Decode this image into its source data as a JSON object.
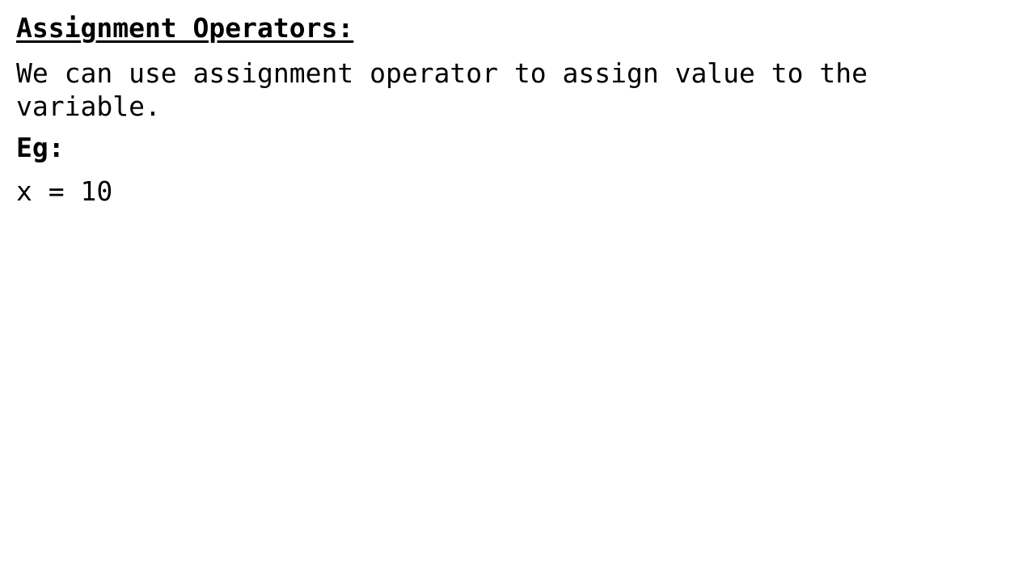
{
  "slide": {
    "heading": "Assignment Operators:",
    "description": "We can use assignment operator to assign value to the variable.",
    "example_label": "Eg:",
    "example_code": "x = 10"
  }
}
